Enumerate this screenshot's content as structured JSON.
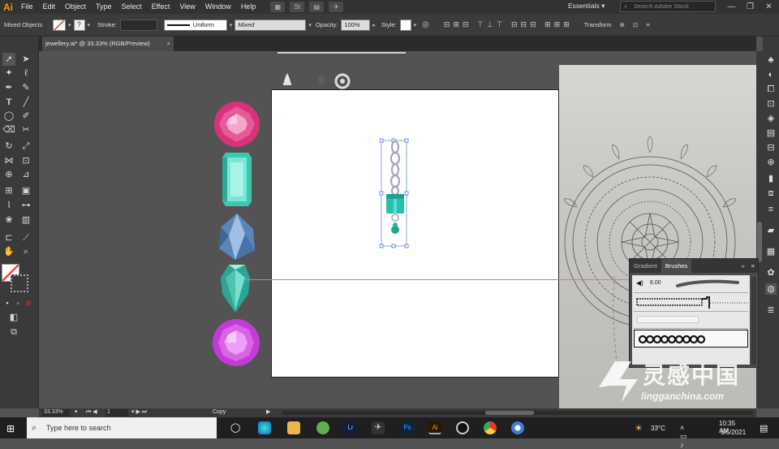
{
  "app": {
    "logo": "Ai",
    "menus": [
      "File",
      "Edit",
      "Object",
      "Type",
      "Select",
      "Effect",
      "View",
      "Window",
      "Help"
    ],
    "workspace": "Essentials",
    "search_placeholder": "Search Adobe Stock",
    "window_buttons": [
      "—",
      "❐",
      "✕"
    ]
  },
  "control_bar": {
    "selection": "Mixed Objects",
    "stroke_label": "Stroke:",
    "stroke_profile": "Uniform",
    "brush_value": "Mixed",
    "opacity_label": "Opacity:",
    "opacity_value": "100%",
    "style_label": "Style:",
    "transform_label": "Transform"
  },
  "document": {
    "tab_title": "jewellery.ai* @ 33.33% (RGB/Preview)",
    "close": "×"
  },
  "panel": {
    "tabs": [
      "Gradient",
      "Brushes"
    ],
    "active_tab": "Brushes",
    "brush_size": "6.00"
  },
  "status": {
    "zoom": "33.33%",
    "artboard_number": "1",
    "tool_name": "Copy"
  },
  "taskbar": {
    "search_placeholder": "Type here to search",
    "weather": "33°C",
    "time": "10:35 AM",
    "date": "6/5/2021"
  },
  "watermark": {
    "brand_cn": "灵感中国",
    "brand_url": "lingganchina.com"
  },
  "colors": {
    "accent_ai": "#ff9a00",
    "guide": "#d36bdb",
    "ruby": "#d6337a",
    "emerald": "#3cc7b0",
    "sapphire": "#5b86b8",
    "amethyst": "#c43ad6"
  }
}
